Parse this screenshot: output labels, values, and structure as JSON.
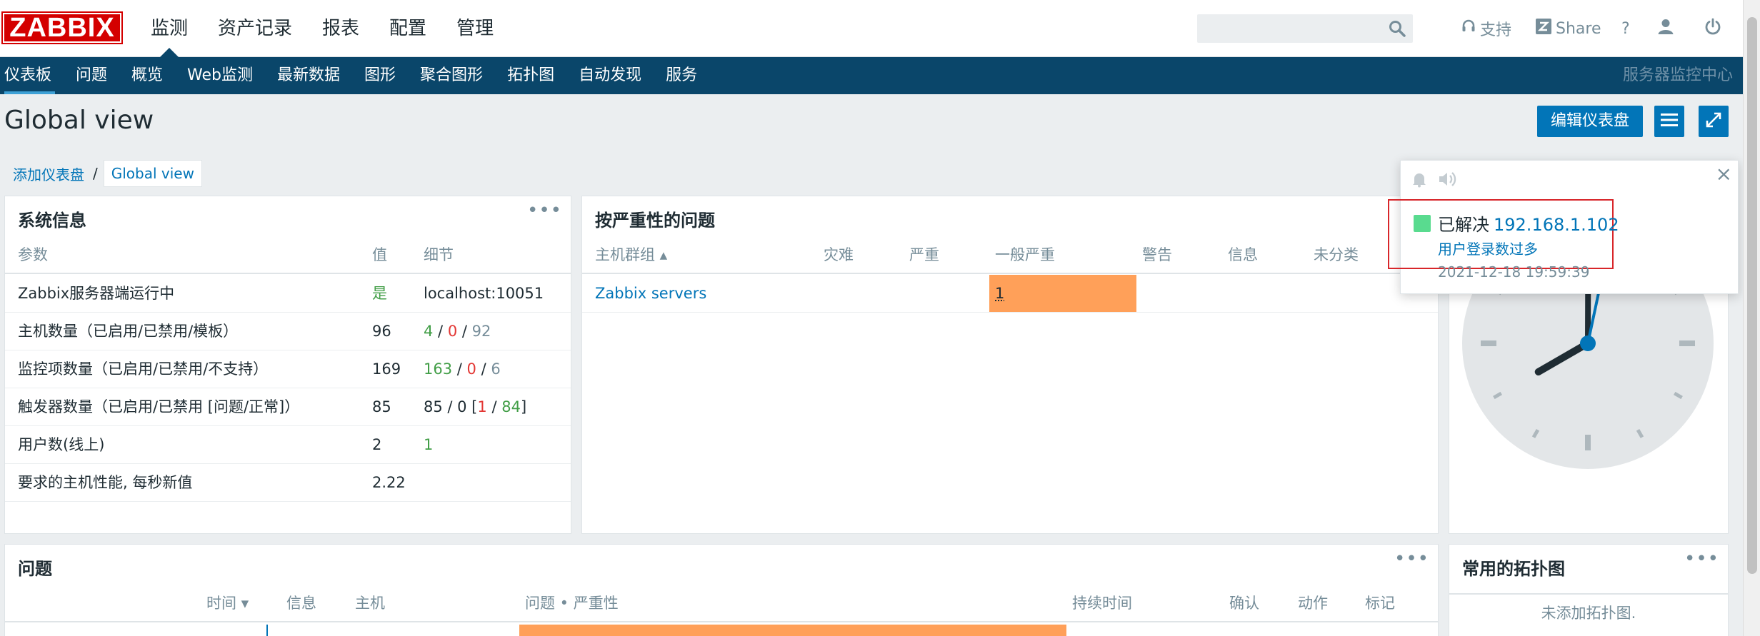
{
  "brand": {
    "logo_text": "ZABBIX",
    "color": "#d40000"
  },
  "main_menu": [
    {
      "label": "监测",
      "active": true
    },
    {
      "label": "资产记录"
    },
    {
      "label": "报表"
    },
    {
      "label": "配置"
    },
    {
      "label": "管理"
    }
  ],
  "header_tools": {
    "search_placeholder": "",
    "support_label": "支持",
    "share_label": "Share",
    "help_label": "?"
  },
  "sub_menu": [
    {
      "label": "仪表板",
      "active": true
    },
    {
      "label": "问题"
    },
    {
      "label": "概览"
    },
    {
      "label": "Web监测"
    },
    {
      "label": "最新数据"
    },
    {
      "label": "图形"
    },
    {
      "label": "聚合图形"
    },
    {
      "label": "拓扑图"
    },
    {
      "label": "自动发现"
    },
    {
      "label": "服务"
    }
  ],
  "sub_menu_right": "服务器监控中心",
  "page": {
    "title": "Global view",
    "edit_button": "编辑仪表盘"
  },
  "breadcrumb": {
    "parent": "添加仪表盘",
    "separator": "/",
    "current": "Global view"
  },
  "system_info": {
    "title": "系统信息",
    "menu": "•••",
    "headers": {
      "param": "参数",
      "value": "值",
      "detail": "细节"
    },
    "rows": [
      {
        "param": "Zabbix服务器端运行中",
        "value": "是",
        "detail": "localhost:10051"
      },
      {
        "param": "主机数量（已启用/已禁用/模板）",
        "value": "96",
        "d1": "4",
        "s1": " / ",
        "d2": "0",
        "s2": " / ",
        "d3": "92"
      },
      {
        "param": "监控项数量（已启用/已禁用/不支持）",
        "value": "169",
        "d1": "163",
        "s1": " / ",
        "d2": "0",
        "s2": " / ",
        "d3": "6"
      },
      {
        "param": "触发器数量（已启用/已禁用 [问题/正常]）",
        "value": "85",
        "d0": "85 / 0 [",
        "d1": "1",
        "s1": " / ",
        "d2": "84",
        "d3": "]"
      },
      {
        "param": "用户数(线上)",
        "value": "2",
        "detail": "1"
      },
      {
        "param": "要求的主机性能, 每秒新值",
        "value": "2.22",
        "detail": ""
      }
    ]
  },
  "problems_by_severity": {
    "title": "按严重性的问题",
    "headers": [
      "主机群组 ▴",
      "灾难",
      "严重",
      "一般严重",
      "警告",
      "信息",
      "未分类"
    ],
    "rows": [
      {
        "group": "Zabbix servers",
        "average": "1"
      }
    ]
  },
  "problems": {
    "title": "问题",
    "menu": "•••",
    "headers": [
      "时间 ▾",
      "信息",
      "主机",
      "问题 • 严重性",
      "持续时间",
      "确认",
      "动作",
      "标记"
    ]
  },
  "favorite_maps": {
    "title": "常用的拓扑图",
    "menu": "•••",
    "empty_text": "未添加拓扑图."
  },
  "clock": {
    "hour": 8,
    "minute": 0,
    "second": 2
  },
  "notification": {
    "close": "×",
    "status": "已解决",
    "host": "192.168.1.102",
    "problem": "用户登录数过多",
    "time": "2021-12-18 19:59:39",
    "status_color": "#59db8f"
  },
  "colors": {
    "accent": "#0275b8",
    "nav_dark": "#0a466a",
    "severity_average": "#ffa059",
    "ok_green": "#429e47",
    "problem_red": "#e33734"
  }
}
